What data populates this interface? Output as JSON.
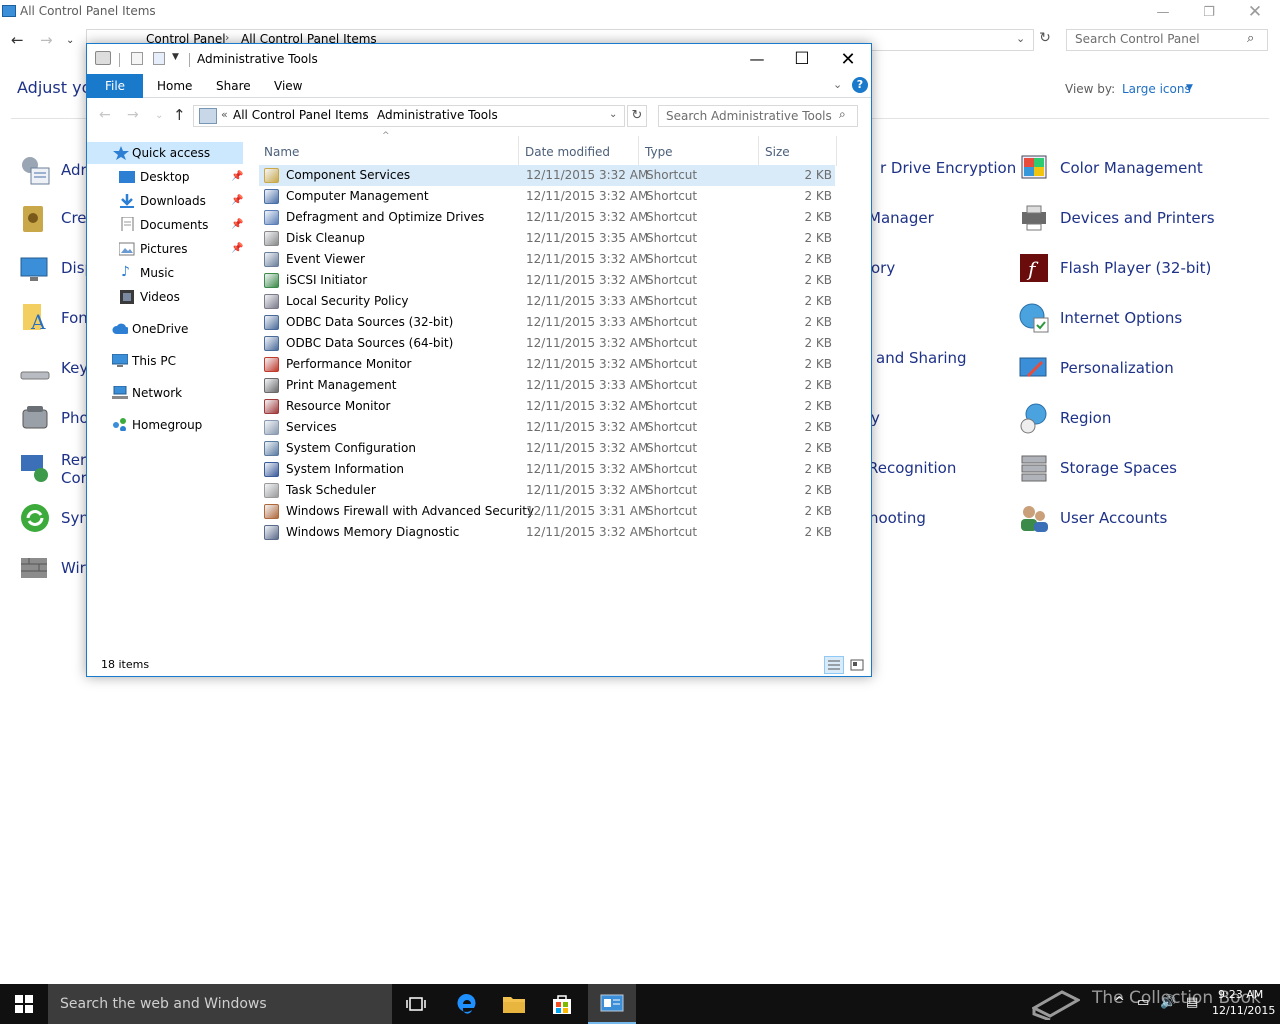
{
  "control_panel": {
    "title": "All Control Panel Items",
    "address": [
      "Control Panel",
      "All Control Panel Items"
    ],
    "search_placeholder": "Search Control Panel",
    "heading": "Adjust you",
    "view_by_label": "View by:",
    "view_by_value": "Large icons",
    "left_items": [
      "Adr",
      "Cre",
      "Disp",
      "Fon",
      "Key",
      "Pho",
      "Rer",
      "Cor",
      "Syn",
      "Wir"
    ],
    "middle_fragments": [
      "r Drive Encryption",
      "Manager",
      "ory",
      "and Sharing",
      "y",
      "Recognition",
      "hooting"
    ],
    "right_items": [
      {
        "label": "Color Management",
        "icon": "color-management-icon"
      },
      {
        "label": "Devices and Printers",
        "icon": "devices-printers-icon"
      },
      {
        "label": "Flash Player (32-bit)",
        "icon": "flash-player-icon"
      },
      {
        "label": "Internet Options",
        "icon": "internet-options-icon"
      },
      {
        "label": "Personalization",
        "icon": "personalization-icon"
      },
      {
        "label": "Region",
        "icon": "region-icon"
      },
      {
        "label": "Storage Spaces",
        "icon": "storage-spaces-icon"
      },
      {
        "label": "User Accounts",
        "icon": "user-accounts-icon"
      }
    ]
  },
  "explorer": {
    "title": "Administrative Tools",
    "ribbon_tabs": [
      "File",
      "Home",
      "Share",
      "View"
    ],
    "help": "?",
    "address": [
      "All Control Panel Items",
      "Administrative Tools"
    ],
    "address_prefix": "«",
    "search_placeholder": "Search Administrative Tools",
    "nav": {
      "quick_access": "Quick access",
      "desktop": "Desktop",
      "downloads": "Downloads",
      "documents": "Documents",
      "pictures": "Pictures",
      "music": "Music",
      "videos": "Videos",
      "onedrive": "OneDrive",
      "this_pc": "This PC",
      "network": "Network",
      "homegroup": "Homegroup"
    },
    "columns": {
      "name": "Name",
      "date": "Date modified",
      "type": "Type",
      "size": "Size"
    },
    "files": [
      {
        "name": "Component Services",
        "date": "12/11/2015 3:32 AM",
        "type": "Shortcut",
        "size": "2 KB",
        "color": "#c9a84a"
      },
      {
        "name": "Computer Management",
        "date": "12/11/2015 3:32 AM",
        "type": "Shortcut",
        "size": "2 KB",
        "color": "#4a6fa8"
      },
      {
        "name": "Defragment and Optimize Drives",
        "date": "12/11/2015 3:32 AM",
        "type": "Shortcut",
        "size": "2 KB",
        "color": "#5b7fb8"
      },
      {
        "name": "Disk Cleanup",
        "date": "12/11/2015 3:35 AM",
        "type": "Shortcut",
        "size": "2 KB",
        "color": "#8a8a8a"
      },
      {
        "name": "Event Viewer",
        "date": "12/11/2015 3:32 AM",
        "type": "Shortcut",
        "size": "2 KB",
        "color": "#6a7f9a"
      },
      {
        "name": "iSCSI Initiator",
        "date": "12/11/2015 3:32 AM",
        "type": "Shortcut",
        "size": "2 KB",
        "color": "#3c8a4a"
      },
      {
        "name": "Local Security Policy",
        "date": "12/11/2015 3:33 AM",
        "type": "Shortcut",
        "size": "2 KB",
        "color": "#7a7a8a"
      },
      {
        "name": "ODBC Data Sources (32-bit)",
        "date": "12/11/2015 3:33 AM",
        "type": "Shortcut",
        "size": "2 KB",
        "color": "#4a6a9a"
      },
      {
        "name": "ODBC Data Sources (64-bit)",
        "date": "12/11/2015 3:32 AM",
        "type": "Shortcut",
        "size": "2 KB",
        "color": "#4a6a9a"
      },
      {
        "name": "Performance Monitor",
        "date": "12/11/2015 3:32 AM",
        "type": "Shortcut",
        "size": "2 KB",
        "color": "#c0392b"
      },
      {
        "name": "Print Management",
        "date": "12/11/2015 3:33 AM",
        "type": "Shortcut",
        "size": "2 KB",
        "color": "#6a6a6a"
      },
      {
        "name": "Resource Monitor",
        "date": "12/11/2015 3:32 AM",
        "type": "Shortcut",
        "size": "2 KB",
        "color": "#a03a3a"
      },
      {
        "name": "Services",
        "date": "12/11/2015 3:32 AM",
        "type": "Shortcut",
        "size": "2 KB",
        "color": "#8a9ab0"
      },
      {
        "name": "System Configuration",
        "date": "12/11/2015 3:32 AM",
        "type": "Shortcut",
        "size": "2 KB",
        "color": "#5a7aa0"
      },
      {
        "name": "System Information",
        "date": "12/11/2015 3:32 AM",
        "type": "Shortcut",
        "size": "2 KB",
        "color": "#3a5a9a"
      },
      {
        "name": "Task Scheduler",
        "date": "12/11/2015 3:32 AM",
        "type": "Shortcut",
        "size": "2 KB",
        "color": "#9a9a9a"
      },
      {
        "name": "Windows Firewall with Advanced Security",
        "date": "12/11/2015 3:31 AM",
        "type": "Shortcut",
        "size": "2 KB",
        "color": "#b0683a"
      },
      {
        "name": "Windows Memory Diagnostic",
        "date": "12/11/2015 3:32 AM",
        "type": "Shortcut",
        "size": "2 KB",
        "color": "#5a6a8a"
      }
    ],
    "status_count": "18 items"
  },
  "taskbar": {
    "search_placeholder": "Search the web and Windows",
    "watermark": "The Collection Book",
    "time": "9:23 AM",
    "date": "12/11/2015"
  }
}
